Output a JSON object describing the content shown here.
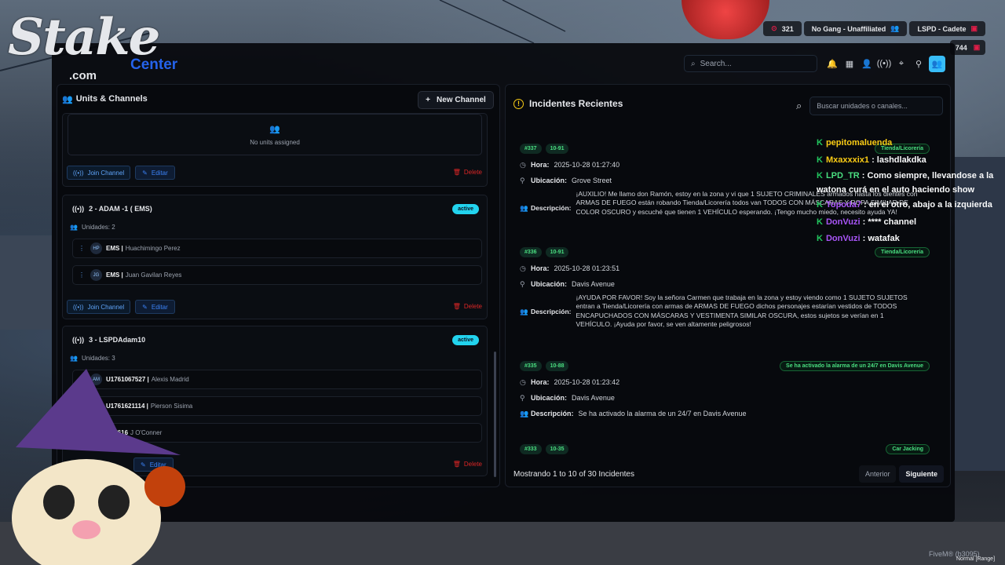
{
  "hud": {
    "cash": "321",
    "gang": "No Gang - Unaffiliated",
    "job": "LSPD - Cadete",
    "secondary": "744"
  },
  "app": {
    "title": "Center",
    "search_placeholder": "Search..."
  },
  "left_panel": {
    "title": "Units & Channels",
    "new_channel": "New Channel",
    "no_units": "No units assigned",
    "join_label": "Join Channel",
    "edit_label": "Editar",
    "delete_label": "Delete",
    "channels": [
      {
        "title": "2 - ADAM -1 ( EMS)",
        "status": "active",
        "units_label": "Unidades: 2",
        "units": [
          {
            "initials": "HP",
            "id": "EMS |",
            "name": "Huachimingo Perez"
          },
          {
            "initials": "JG",
            "id": "EMS |",
            "name": "Juan Gavilan Reyes"
          }
        ]
      },
      {
        "title": "3 - LSPDAdam10",
        "status": "active",
        "units_label": "Unidades: 3",
        "units": [
          {
            "initials": "AM",
            "id": "U1761067527 |",
            "name": "Alexis Madrid"
          },
          {
            "initials": "PS",
            "id": "U1761621114 |",
            "name": "Pierson Sisima"
          },
          {
            "initials": "JO",
            "id": "U17616",
            "name": "J O'Conner"
          }
        ]
      }
    ]
  },
  "right_panel": {
    "title": "Incidentes Recientes",
    "search_placeholder": "Buscar unidades o canales...",
    "labels": {
      "time": "Hora:",
      "location": "Ubicación:",
      "description": "Descripción:"
    },
    "incidents": [
      {
        "id": "#337",
        "code": "10-91",
        "category": "Tienda/Licorería",
        "time": "2025-10-28 01:27:40",
        "location": "Grove Street",
        "description": "¡AUXILIO! Me llamo don Ramón, estoy en la zona y vi que 1 SUJETO CRIMINALES armados hasta los dientes con ARMAS DE FUEGO están robando Tienda/Licorería todos van TODOS CON MÁSCARAS Y ROPA SIMILAR DE COLOR OSCURO y escuché que tienen 1 VEHÍCULO esperando. ¡Tengo mucho miedo, necesito ayuda YA!"
      },
      {
        "id": "#336",
        "code": "10-91",
        "category": "Tienda/Licorería",
        "time": "2025-10-28 01:23:51",
        "location": "Davis Avenue",
        "description": "¡AYUDA POR FAVOR! Soy la señora Carmen que trabaja en la zona y estoy viendo como 1 SUJETO SUJETOS entran a Tienda/Licorería con armas de ARMAS DE FUEGO dichos personajes estarían vestidos de TODOS ENCAPUCHADOS CON MÁSCARAS Y VESTIMENTA SIMILAR OSCURA, estos sujetos se verían en 1 VEHÍCULO. ¡Ayuda por favor, se ven altamente peligrosos!"
      },
      {
        "id": "#335",
        "code": "10-88",
        "category": "Se ha activado la alarma de un 24/7 en Davis Avenue",
        "time": "2025-10-28 01:23:42",
        "location": "Davis Avenue",
        "description": "Se ha activado la alarma de un 24/7 en Davis Avenue"
      },
      {
        "id": "#333",
        "code": "10-35",
        "category": "Car Jacking"
      }
    ],
    "footer": "Mostrando 1 to 10 of 30 Incidentes",
    "prev": "Anterior",
    "next": "Siguiente"
  },
  "chat": [
    {
      "user": "pepitomaluenda",
      "msg": ""
    },
    {
      "user": "Mxaxxxix1",
      "msg": ": lashdlakdka"
    },
    {
      "user": "LPD_TR",
      "msg": ": Como siempre, llevandose a la watona curá en el auto haciendo show"
    },
    {
      "user": "Topoda7",
      "msg": ": en el otro, abajo a la izquierda"
    },
    {
      "user": "DonVuzi",
      "msg": ": **** channel"
    },
    {
      "user": "DonVuzi",
      "msg": ": watafak"
    }
  ],
  "overlay": {
    "logo": "Stake",
    "logo_sub": ".com",
    "fivem": "FiveM® (b3095)",
    "mode": "Normal [Range]"
  }
}
